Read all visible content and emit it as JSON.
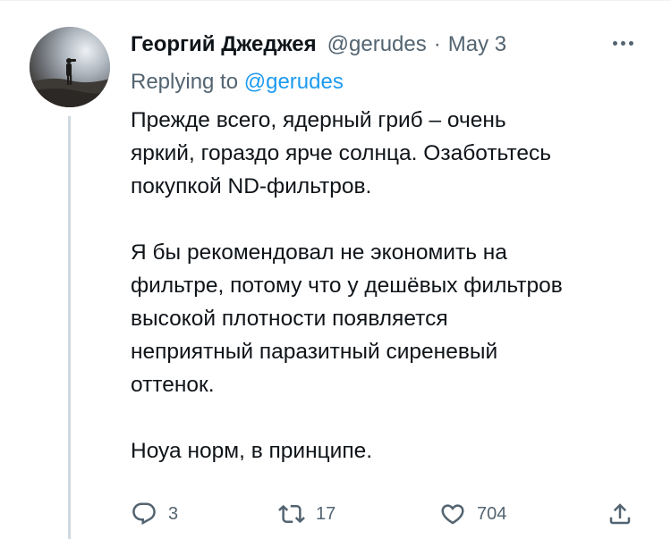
{
  "tweet": {
    "author_name": "Георгий Джеджея",
    "handle": "@gerudes",
    "separator": "·",
    "date": "May 3",
    "replying_prefix": "Replying to",
    "replying_to": "@gerudes",
    "paragraphs": [
      [
        "Прежде всего, ядерный гриб – очень",
        "яркий, гораздо ярче солнца. Озаботьтесь",
        "покупкой ND-фильтров."
      ],
      [
        "Я бы рекомендовал не экономить на",
        "фильтре, потому что у дешёвых фильтров",
        "высокой плотности появляется",
        "неприятный паразитный сиреневый",
        "оттенок."
      ],
      [
        "Ноуа норм, в принципе."
      ]
    ],
    "actions": {
      "reply_icon": "reply-icon",
      "reply_count": "3",
      "retweet_icon": "retweet-icon",
      "retweet_count": "17",
      "like_icon": "heart-icon",
      "like_count": "704",
      "share_icon": "share-icon"
    },
    "more_icon": "more-horizontal-icon"
  },
  "colors": {
    "text": "#0f1419",
    "secondary": "#536471",
    "accent": "#1d9bf0",
    "thread_line": "#cfd9de"
  }
}
